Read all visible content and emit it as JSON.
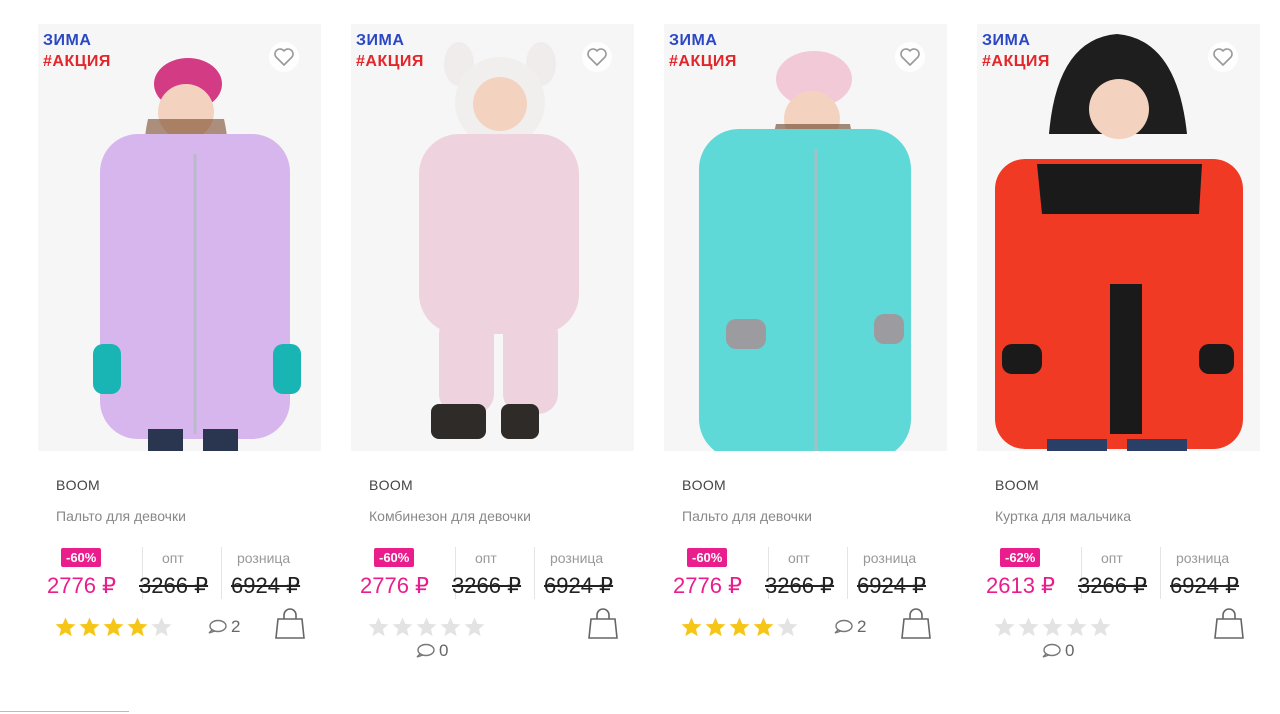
{
  "colors": {
    "season": "#2b47c4",
    "promo": "#e3262a",
    "accent": "#e91e8c",
    "star_on": "#f5c518",
    "star_off": "#e3e3e3"
  },
  "labels": {
    "opt": "опт",
    "retail": "розница"
  },
  "products": [
    {
      "season": "ЗИМА",
      "promo": "#АКЦИЯ",
      "brand": "BOOM",
      "name": "Пальто для девочки",
      "discount": "-60%",
      "price_now": "2776 ₽",
      "price_opt": "3266 ₽",
      "price_retail": "6924 ₽",
      "rating": 4,
      "comments": "2",
      "garment_color": "#d7b6ee",
      "icons": [
        "heart-icon",
        "star-icon",
        "comment-icon",
        "bag-icon"
      ]
    },
    {
      "season": "ЗИМА",
      "promo": "#АКЦИЯ",
      "brand": "BOOM",
      "name": "Комбинезон для девочки",
      "discount": "-60%",
      "price_now": "2776 ₽",
      "price_opt": "3266 ₽",
      "price_retail": "6924 ₽",
      "rating": 0,
      "comments": "0",
      "garment_color": "#eed3de",
      "icons": [
        "heart-icon",
        "star-icon",
        "comment-icon",
        "bag-icon"
      ]
    },
    {
      "season": "ЗИМА",
      "promo": "#АКЦИЯ",
      "brand": "BOOM",
      "name": "Пальто для девочки",
      "discount": "-60%",
      "price_now": "2776 ₽",
      "price_opt": "3266 ₽",
      "price_retail": "6924 ₽",
      "rating": 4,
      "comments": "2",
      "garment_color": "#5fd8d8",
      "icons": [
        "heart-icon",
        "star-icon",
        "comment-icon",
        "bag-icon"
      ]
    },
    {
      "season": "ЗИМА",
      "promo": "#АКЦИЯ",
      "brand": "BOOM",
      "name": "Куртка для мальчика",
      "discount": "-62%",
      "price_now": "2613 ₽",
      "price_opt": "3266 ₽",
      "price_retail": "6924 ₽",
      "rating": 0,
      "comments": "0",
      "garment_color": "#f03a24",
      "icons": [
        "heart-icon",
        "star-icon",
        "comment-icon",
        "bag-icon"
      ]
    }
  ]
}
